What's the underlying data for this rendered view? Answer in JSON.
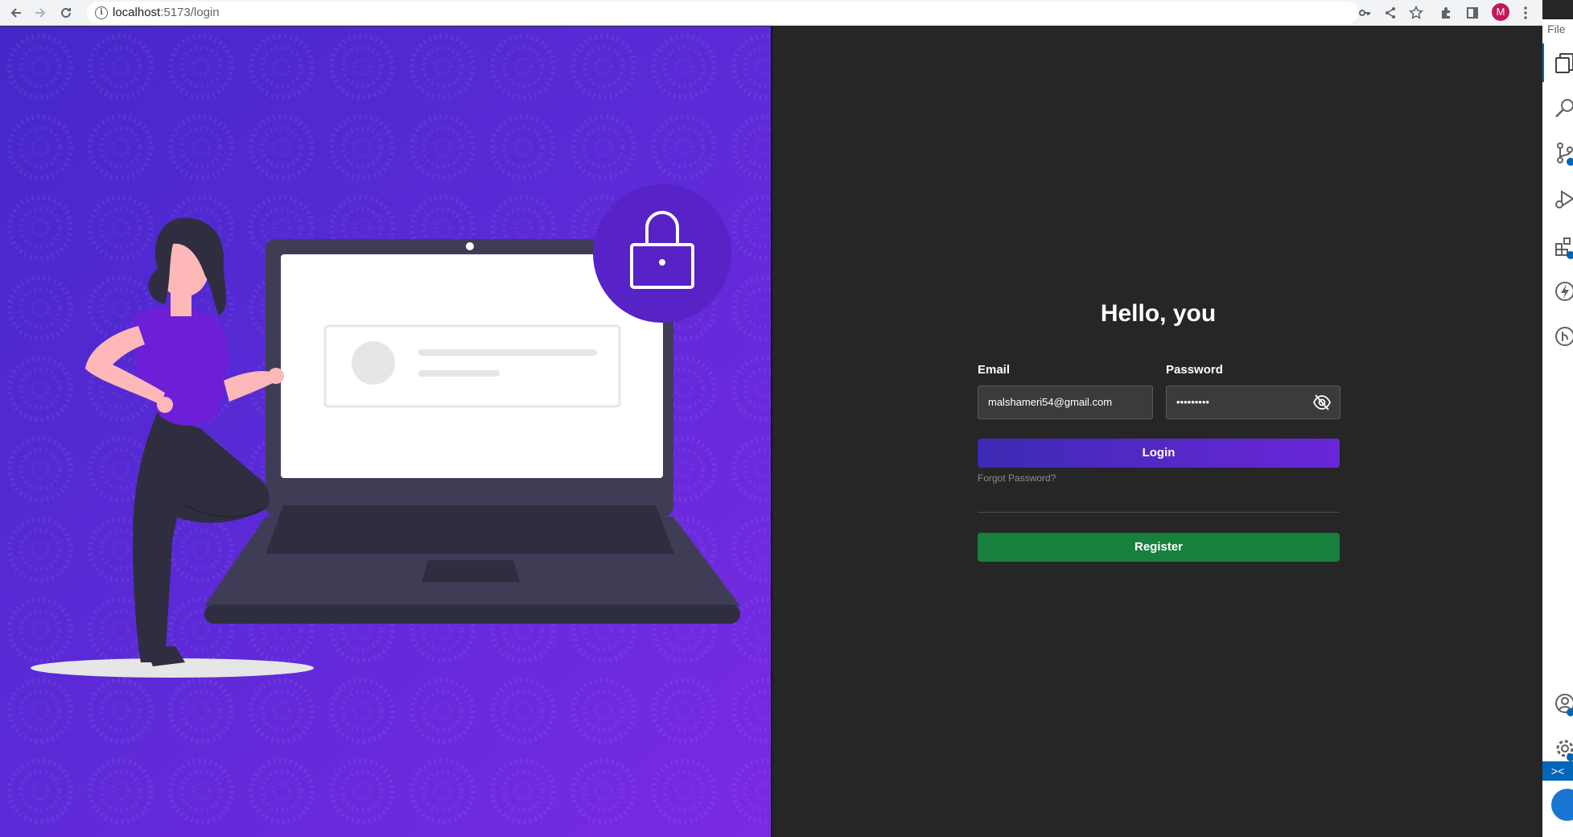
{
  "browser": {
    "url_host": "localhost",
    "url_path": ":5173/login",
    "avatar_letter": "M",
    "icons": [
      "back-icon",
      "forward-icon",
      "reload-icon",
      "info-icon",
      "key-icon",
      "share-icon",
      "star-icon",
      "extensions-icon",
      "side-panel-icon",
      "menu-dots-icon"
    ]
  },
  "illustration": {
    "icons": [
      "lock-icon",
      "laptop-illustration",
      "woman-illustration"
    ]
  },
  "login": {
    "title": "Hello, you",
    "email_label": "Email",
    "email_value": "malshameri54@gmail.com",
    "password_label": "Password",
    "password_value": "•••••••••",
    "login_button": "Login",
    "forgot_link": "Forgot Password?",
    "register_button": "Register"
  },
  "vscode": {
    "menu_file": "File",
    "remote_label": "><"
  },
  "colors": {
    "hero_gradient_start": "#4528c9",
    "hero_gradient_end": "#7a2ae3",
    "panel_bg": "#262626",
    "login_button": "#5a2ad6",
    "register_button": "#17803d",
    "input_bg": "#3b3b3b"
  }
}
